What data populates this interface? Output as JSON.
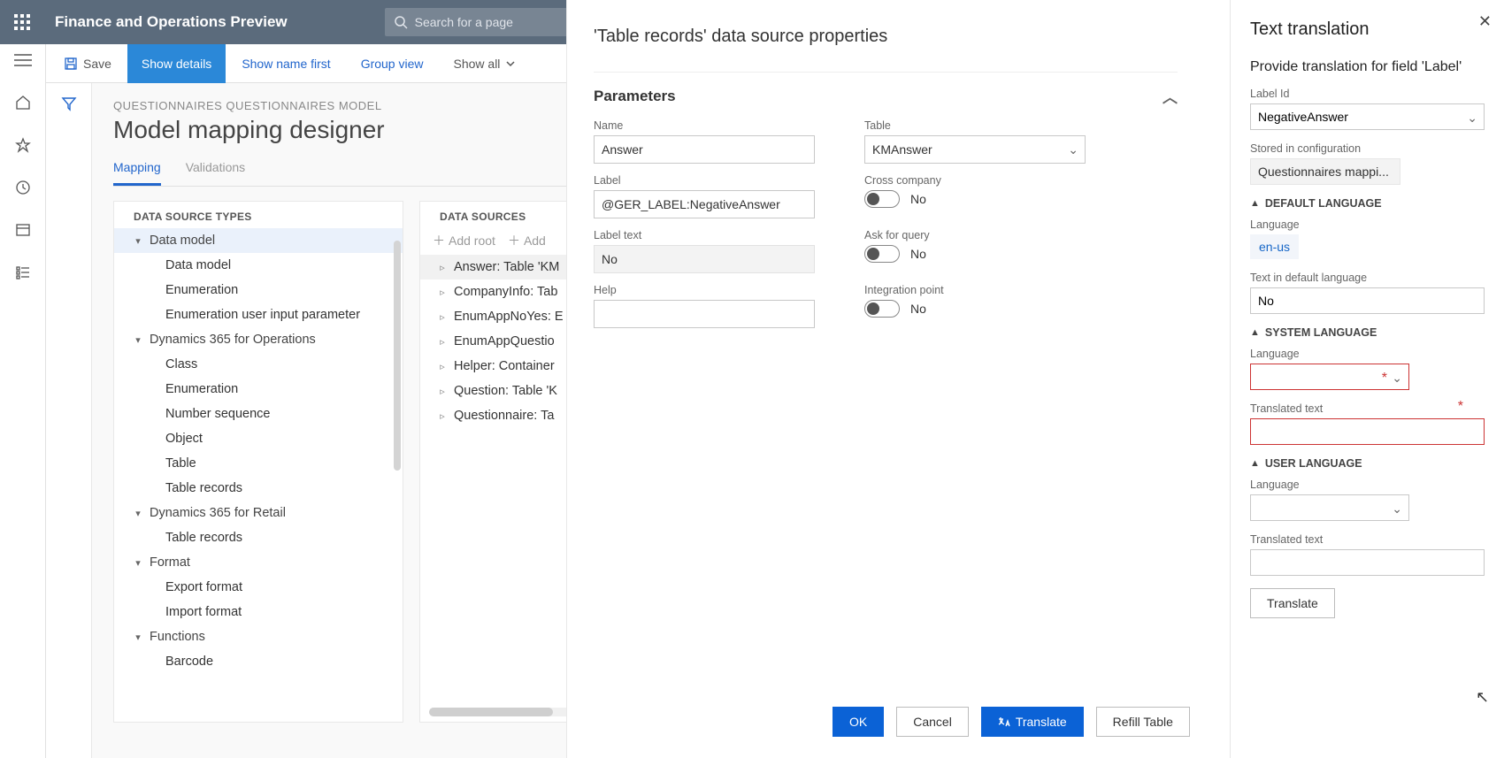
{
  "topbar": {
    "app_title": "Finance and Operations Preview",
    "search_placeholder": "Search for a page"
  },
  "toolbar": {
    "save": "Save",
    "show_details": "Show details",
    "show_name_first": "Show name first",
    "group_view": "Group view",
    "show_all": "Show all"
  },
  "page": {
    "breadcrumb": "QUESTIONNAIRES QUESTIONNAIRES MODEL",
    "title": "Model mapping designer",
    "tabs": {
      "mapping": "Mapping",
      "validations": "Validations"
    }
  },
  "ds_types": {
    "header": "DATA SOURCE TYPES",
    "items": [
      {
        "label": "Data model",
        "lv": 0,
        "caret": "▾",
        "sel": true
      },
      {
        "label": "Data model",
        "lv": 1
      },
      {
        "label": "Enumeration",
        "lv": 1
      },
      {
        "label": "Enumeration user input parameter",
        "lv": 1
      },
      {
        "label": "Dynamics 365 for Operations",
        "lv": 0,
        "caret": "▾"
      },
      {
        "label": "Class",
        "lv": 1
      },
      {
        "label": "Enumeration",
        "lv": 1
      },
      {
        "label": "Number sequence",
        "lv": 1
      },
      {
        "label": "Object",
        "lv": 1
      },
      {
        "label": "Table",
        "lv": 1
      },
      {
        "label": "Table records",
        "lv": 1
      },
      {
        "label": "Dynamics 365 for Retail",
        "lv": 0,
        "caret": "▾"
      },
      {
        "label": "Table records",
        "lv": 1
      },
      {
        "label": "Format",
        "lv": 0,
        "caret": "▾"
      },
      {
        "label": "Export format",
        "lv": 1
      },
      {
        "label": "Import format",
        "lv": 1
      },
      {
        "label": "Functions",
        "lv": 0,
        "caret": "▾"
      },
      {
        "label": "Barcode",
        "lv": 1
      }
    ]
  },
  "ds": {
    "header": "DATA SOURCES",
    "add_root": "Add root",
    "add": "Add",
    "items": [
      {
        "label": "Answer: Table 'KM",
        "sel": true
      },
      {
        "label": "CompanyInfo: Tab"
      },
      {
        "label": "EnumAppNoYes: E"
      },
      {
        "label": "EnumAppQuestio"
      },
      {
        "label": "Helper: Container"
      },
      {
        "label": "Question: Table 'K"
      },
      {
        "label": "Questionnaire: Ta"
      }
    ]
  },
  "dialog": {
    "title": "'Table records' data source properties",
    "section": "Parameters",
    "labels": {
      "name": "Name",
      "label": "Label",
      "label_text": "Label text",
      "help": "Help",
      "table": "Table",
      "cross": "Cross company",
      "ask": "Ask for query",
      "integration": "Integration point"
    },
    "values": {
      "name": "Answer",
      "label": "@GER_LABEL:NegativeAnswer",
      "label_text": "No",
      "help": "",
      "table": "KMAnswer",
      "no": "No"
    },
    "buttons": {
      "ok": "OK",
      "cancel": "Cancel",
      "translate": "Translate",
      "refill": "Refill Table"
    }
  },
  "trans": {
    "title": "Text translation",
    "subtitle": "Provide translation for field 'Label'",
    "label_id_label": "Label Id",
    "label_id": "NegativeAnswer",
    "stored_label": "Stored in configuration",
    "stored_value": "Questionnaires mappi...",
    "groups": {
      "default": "DEFAULT LANGUAGE",
      "system": "SYSTEM LANGUAGE",
      "user": "USER LANGUAGE"
    },
    "language_label": "Language",
    "default_lang": "en-us",
    "text_default_label": "Text in default language",
    "text_default_value": "No",
    "translated_text_label": "Translated text",
    "translate_btn": "Translate"
  }
}
